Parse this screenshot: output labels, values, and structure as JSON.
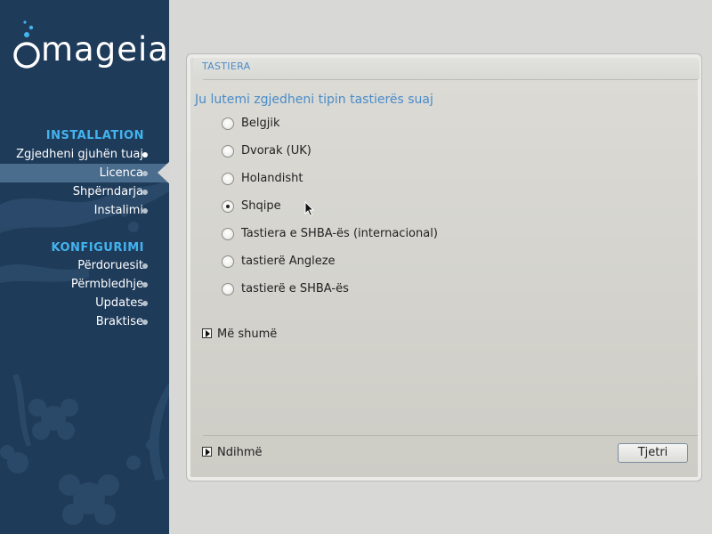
{
  "brand": {
    "logo_text": "mageia"
  },
  "sidebar": {
    "sections": [
      {
        "title": "INSTALLATION",
        "items": [
          {
            "label": "Zgjedheni gjuhën tuaj",
            "state": "done"
          },
          {
            "label": "Licenca",
            "state": "active"
          },
          {
            "label": "Shpërndarja",
            "state": "pending"
          },
          {
            "label": "Instalimi",
            "state": "pending"
          }
        ]
      },
      {
        "title": "KONFIGURIMI",
        "items": [
          {
            "label": "Përdoruesit",
            "state": "pending"
          },
          {
            "label": "Përmbledhje",
            "state": "pending"
          },
          {
            "label": "Updates",
            "state": "pending"
          },
          {
            "label": "Braktise",
            "state": "pending"
          }
        ]
      }
    ]
  },
  "panel": {
    "title": "TASTIERA",
    "prompt": "Ju lutemi zgjedheni tipin tastierës suaj",
    "options": [
      {
        "label": "Belgjik",
        "selected": false
      },
      {
        "label": "Dvorak (UK)",
        "selected": false
      },
      {
        "label": "Holandisht",
        "selected": false
      },
      {
        "label": "Shqipe",
        "selected": true
      },
      {
        "label": "Tastiera e SHBA-ës (internacional)",
        "selected": false
      },
      {
        "label": "tastierë Angleze",
        "selected": false
      },
      {
        "label": "tastierë e SHBA-ës",
        "selected": false
      }
    ],
    "more_label": "Më shumë",
    "help_label": "Ndihmë",
    "next_label": "Tjetri"
  },
  "colors": {
    "sidebar_bg": "#1f3b5a",
    "section_title": "#43b3ee",
    "active_item": "#4a6c8d",
    "accent_text": "#4a8bc9"
  },
  "icons": [
    "mageia-logo-icon",
    "radio-icon",
    "expander-arrow-icon",
    "mouse-cursor-icon"
  ]
}
